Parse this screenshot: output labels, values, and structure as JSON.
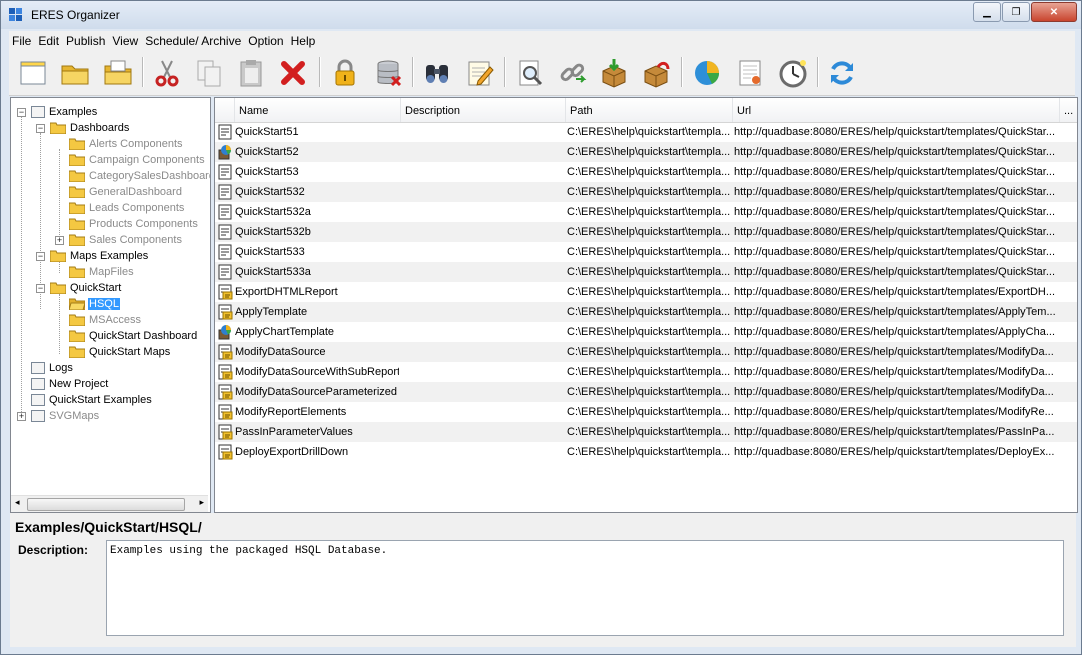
{
  "window": {
    "title": "ERES Organizer"
  },
  "menu": [
    "File",
    "Edit",
    "Publish",
    "View",
    "Schedule/ Archive",
    "Option",
    "Help"
  ],
  "toolbar": [
    "new-project-icon",
    "open-folder-icon",
    "folder-group-icon",
    "cut-icon",
    "copy-icon",
    "paste-icon",
    "delete-icon",
    "lock-icon",
    "database-icon",
    "binoculars-icon",
    "edit-notes-icon",
    "preview-icon",
    "link-icon",
    "import-box-icon",
    "export-box-icon",
    "pie-chart-icon",
    "report-icon",
    "scheduler-clock-icon",
    "refresh-icon"
  ],
  "tree": {
    "items": [
      {
        "label": "Examples"
      },
      {
        "label": "Dashboards"
      },
      {
        "label": "Alerts Components"
      },
      {
        "label": "Campaign Components"
      },
      {
        "label": "CategorySalesDashboard"
      },
      {
        "label": "GeneralDashboard"
      },
      {
        "label": "Leads Components"
      },
      {
        "label": "Products Components"
      },
      {
        "label": "Sales Components"
      },
      {
        "label": "Maps Examples"
      },
      {
        "label": "MapFiles"
      },
      {
        "label": "QuickStart"
      },
      {
        "label": "HSQL"
      },
      {
        "label": "MSAccess"
      },
      {
        "label": "QuickStart Dashboard"
      },
      {
        "label": "QuickStart Maps"
      },
      {
        "label": "Logs"
      },
      {
        "label": "New Project"
      },
      {
        "label": "QuickStart Examples"
      },
      {
        "label": "SVGMaps"
      }
    ]
  },
  "table": {
    "columns": [
      "Name",
      "Description",
      "Path",
      "Url",
      "..."
    ],
    "rows": [
      {
        "icon": "report",
        "name": "QuickStart51",
        "path": "C:\\ERES\\help\\quickstart\\templa...",
        "url": "http://quadbase:8080/ERES/help/quickstart/templates/QuickStar..."
      },
      {
        "icon": "chart",
        "name": "QuickStart52",
        "path": "C:\\ERES\\help\\quickstart\\templa...",
        "url": "http://quadbase:8080/ERES/help/quickstart/templates/QuickStar..."
      },
      {
        "icon": "report",
        "name": "QuickStart53",
        "path": "C:\\ERES\\help\\quickstart\\templa...",
        "url": "http://quadbase:8080/ERES/help/quickstart/templates/QuickStar..."
      },
      {
        "icon": "report",
        "name": "QuickStart532",
        "path": "C:\\ERES\\help\\quickstart\\templa...",
        "url": "http://quadbase:8080/ERES/help/quickstart/templates/QuickStar..."
      },
      {
        "icon": "report",
        "name": "QuickStart532a",
        "path": "C:\\ERES\\help\\quickstart\\templa...",
        "url": "http://quadbase:8080/ERES/help/quickstart/templates/QuickStar..."
      },
      {
        "icon": "report",
        "name": "QuickStart532b",
        "path": "C:\\ERES\\help\\quickstart\\templa...",
        "url": "http://quadbase:8080/ERES/help/quickstart/templates/QuickStar..."
      },
      {
        "icon": "report",
        "name": "QuickStart533",
        "path": "C:\\ERES\\help\\quickstart\\templa...",
        "url": "http://quadbase:8080/ERES/help/quickstart/templates/QuickStar..."
      },
      {
        "icon": "report",
        "name": "QuickStart533a",
        "path": "C:\\ERES\\help\\quickstart\\templa...",
        "url": "http://quadbase:8080/ERES/help/quickstart/templates/QuickStar..."
      },
      {
        "icon": "code",
        "name": "ExportDHTMLReport",
        "path": "C:\\ERES\\help\\quickstart\\templa...",
        "url": "http://quadbase:8080/ERES/help/quickstart/templates/ExportDH..."
      },
      {
        "icon": "code",
        "name": "ApplyTemplate",
        "path": "C:\\ERES\\help\\quickstart\\templa...",
        "url": "http://quadbase:8080/ERES/help/quickstart/templates/ApplyTem..."
      },
      {
        "icon": "chart",
        "name": "ApplyChartTemplate",
        "path": "C:\\ERES\\help\\quickstart\\templa...",
        "url": "http://quadbase:8080/ERES/help/quickstart/templates/ApplyCha..."
      },
      {
        "icon": "code",
        "name": "ModifyDataSource",
        "path": "C:\\ERES\\help\\quickstart\\templa...",
        "url": "http://quadbase:8080/ERES/help/quickstart/templates/ModifyDa..."
      },
      {
        "icon": "code",
        "name": "ModifyDataSourceWithSubReport",
        "path": "C:\\ERES\\help\\quickstart\\templa...",
        "url": "http://quadbase:8080/ERES/help/quickstart/templates/ModifyDa..."
      },
      {
        "icon": "code",
        "name": "ModifyDataSourceParameterized",
        "path": "C:\\ERES\\help\\quickstart\\templa...",
        "url": "http://quadbase:8080/ERES/help/quickstart/templates/ModifyDa..."
      },
      {
        "icon": "code",
        "name": "ModifyReportElements",
        "path": "C:\\ERES\\help\\quickstart\\templa...",
        "url": "http://quadbase:8080/ERES/help/quickstart/templates/ModifyRe..."
      },
      {
        "icon": "code",
        "name": "PassInParameterValues",
        "path": "C:\\ERES\\help\\quickstart\\templa...",
        "url": "http://quadbase:8080/ERES/help/quickstart/templates/PassInPa..."
      },
      {
        "icon": "code",
        "name": "DeployExportDrillDown",
        "path": "C:\\ERES\\help\\quickstart\\templa...",
        "url": "http://quadbase:8080/ERES/help/quickstart/templates/DeployEx..."
      }
    ]
  },
  "details": {
    "path": "Examples/QuickStart/HSQL/",
    "description_label": "Description:",
    "description": "Examples using the packaged HSQL Database."
  }
}
